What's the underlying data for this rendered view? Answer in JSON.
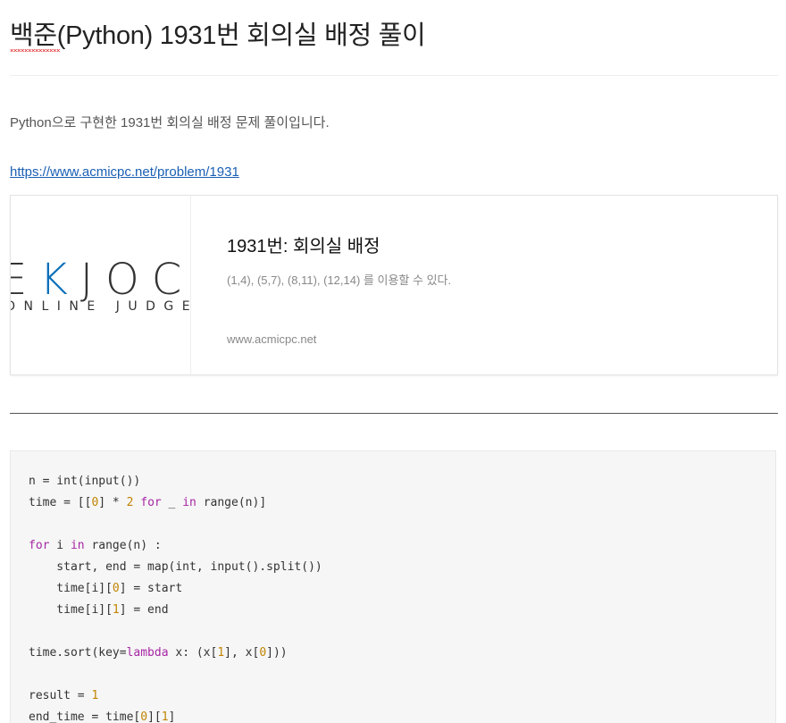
{
  "post": {
    "title": "백준(Python) 1931번 회의실 배정 풀이",
    "intro": "Python으로 구현한 1931번 회의실 배정 문제 풀이입니다.",
    "link": "https://www.acmicpc.net/problem/1931"
  },
  "card": {
    "logo_main": "EKJOC",
    "logo_sub": "ONLINE JUDGE",
    "title": "1931번: 회의실 배정",
    "description": "(1,4), (5,7), (8,11), (12,14) 를 이용할 수 있다.",
    "domain": "www.acmicpc.net"
  },
  "colors": {
    "link": "#1a5fb4",
    "keyword": "#a626a4",
    "number": "#c18401",
    "code_bg": "#f6f6f6"
  },
  "code": [
    [
      {
        "t": "n = int(input())",
        "c": "plain"
      }
    ],
    [
      {
        "t": "time = [[",
        "c": "plain"
      },
      {
        "t": "0",
        "c": "num"
      },
      {
        "t": "] * ",
        "c": "plain"
      },
      {
        "t": "2",
        "c": "num"
      },
      {
        "t": " ",
        "c": "plain"
      },
      {
        "t": "for",
        "c": "kw"
      },
      {
        "t": " _ ",
        "c": "plain"
      },
      {
        "t": "in",
        "c": "kw"
      },
      {
        "t": " range(n)]",
        "c": "plain"
      }
    ],
    [],
    [
      {
        "t": "for",
        "c": "kw"
      },
      {
        "t": " i ",
        "c": "plain"
      },
      {
        "t": "in",
        "c": "kw"
      },
      {
        "t": " range(n) :",
        "c": "plain"
      }
    ],
    [
      {
        "t": "    start, end = map(int, input().split())",
        "c": "plain"
      }
    ],
    [
      {
        "t": "    time[i][",
        "c": "plain"
      },
      {
        "t": "0",
        "c": "num"
      },
      {
        "t": "] = start",
        "c": "plain"
      }
    ],
    [
      {
        "t": "    time[i][",
        "c": "plain"
      },
      {
        "t": "1",
        "c": "num"
      },
      {
        "t": "] = end",
        "c": "plain"
      }
    ],
    [],
    [
      {
        "t": "time.sort(key=",
        "c": "plain"
      },
      {
        "t": "lambda",
        "c": "kw"
      },
      {
        "t": " x: (x[",
        "c": "plain"
      },
      {
        "t": "1",
        "c": "num"
      },
      {
        "t": "], x[",
        "c": "plain"
      },
      {
        "t": "0",
        "c": "num"
      },
      {
        "t": "]))",
        "c": "plain"
      }
    ],
    [],
    [
      {
        "t": "result = ",
        "c": "plain"
      },
      {
        "t": "1",
        "c": "num"
      }
    ],
    [
      {
        "t": "end_time = time[",
        "c": "plain"
      },
      {
        "t": "0",
        "c": "num"
      },
      {
        "t": "][",
        "c": "plain"
      },
      {
        "t": "1",
        "c": "num"
      },
      {
        "t": "]",
        "c": "plain"
      }
    ]
  ]
}
